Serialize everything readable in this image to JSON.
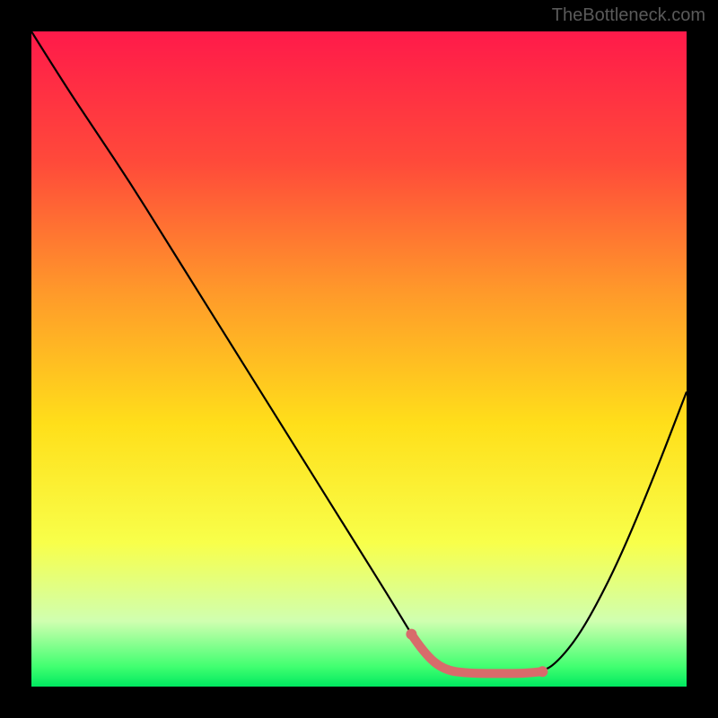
{
  "watermark": "TheBottleneck.com",
  "chart_data": {
    "type": "line",
    "title": "",
    "xlabel": "",
    "ylabel": "",
    "xlim": [
      0,
      100
    ],
    "ylim": [
      0,
      100
    ],
    "gradient_stops": [
      {
        "offset": 0,
        "color": "#ff1a4a"
      },
      {
        "offset": 20,
        "color": "#ff4a3a"
      },
      {
        "offset": 40,
        "color": "#ff9a2a"
      },
      {
        "offset": 60,
        "color": "#ffdf1a"
      },
      {
        "offset": 78,
        "color": "#f8ff4a"
      },
      {
        "offset": 90,
        "color": "#d0ffb0"
      },
      {
        "offset": 97,
        "color": "#40ff70"
      },
      {
        "offset": 100,
        "color": "#00e860"
      }
    ],
    "curve": {
      "x": [
        0,
        5,
        10,
        15,
        20,
        25,
        30,
        35,
        40,
        45,
        50,
        55,
        58,
        60,
        63,
        67,
        72,
        75,
        78,
        80,
        83,
        86,
        90,
        95,
        100
      ],
      "y": [
        100,
        92,
        84.5,
        77,
        69,
        61,
        53,
        45,
        37,
        29,
        21,
        13,
        8,
        5,
        2.5,
        2,
        2,
        2,
        2.3,
        3.5,
        7,
        12,
        20,
        32,
        45
      ]
    },
    "highlight_segment": {
      "x": [
        58,
        60,
        63,
        67,
        72,
        75,
        78
      ],
      "y": [
        8,
        5,
        2.5,
        2,
        2,
        2,
        2.3
      ],
      "color": "#d86b6b"
    }
  }
}
